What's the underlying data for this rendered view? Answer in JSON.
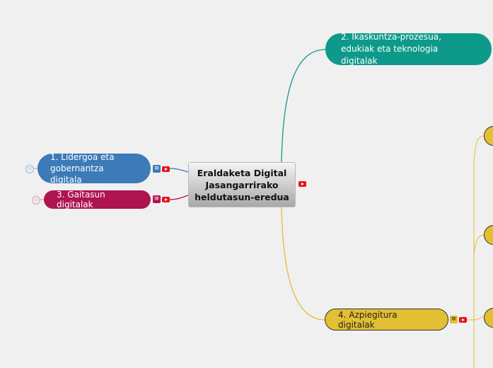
{
  "central": {
    "title": "Eraldaketa Digital Jasangarrirako heldutasun-eredua"
  },
  "branches": [
    {
      "label": "1. Lidergoa eta gobernantza digitala",
      "color": "#3d7ab8",
      "collapsed_count": "20"
    },
    {
      "label": "2. Ikaskuntza-prozesua, edukiak eta teknologia digitalak",
      "color": "#0d9a8a"
    },
    {
      "label": "3. Gaitasun digitalak",
      "color": "#ad1450",
      "collapsed_count": "23"
    },
    {
      "label": "4. Azpiegitura digitalak",
      "color": "#e2bf33"
    }
  ],
  "icons": {
    "note": "notes-icon",
    "video": "youtube-icon"
  }
}
